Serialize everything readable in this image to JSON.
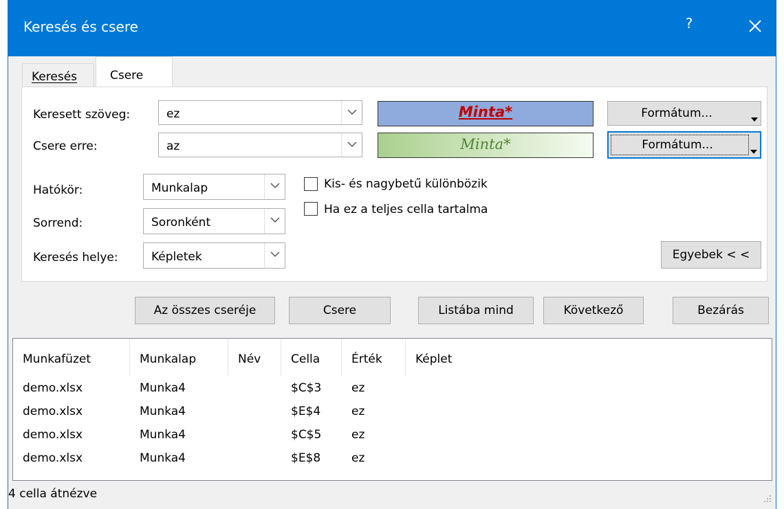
{
  "window": {
    "title": "Keresés és csere",
    "help_label": "?",
    "close_label": "✕"
  },
  "tabs": [
    {
      "label": "Keresés"
    },
    {
      "label": "Csere"
    }
  ],
  "find": {
    "label": "Keresett szöveg:",
    "value": "ez",
    "preview": "Minta*",
    "format_button": "Formátum..."
  },
  "replace": {
    "label": "Csere erre:",
    "value": "az",
    "preview": "Minta*",
    "format_button": "Formátum..."
  },
  "options": {
    "scope_label": "Hatókör:",
    "scope_value": "Munkalap",
    "order_label": "Sorrend:",
    "order_value": "Soronként",
    "lookin_label": "Keresés helye:",
    "lookin_value": "Képletek",
    "match_case": {
      "label": "Kis- és nagybetű különbözik",
      "checked": false
    },
    "match_entire": {
      "label": "Ha ez a teljes cella tartalma",
      "checked": false
    },
    "more_button": "Egyebek < <"
  },
  "actions": {
    "replace_all": "Az összes cseréje",
    "replace": "Csere",
    "find_all": "Listába mind",
    "find_next": "Következő",
    "close": "Bezárás"
  },
  "results": {
    "columns": [
      "Munkafüzet",
      "Munkalap",
      "Név",
      "Cella",
      "Érték",
      "Képlet"
    ],
    "rows": [
      {
        "workbook": "demo.xlsx",
        "sheet": "Munka4",
        "name": "",
        "cell": "$C$3",
        "value": "ez",
        "formula": ""
      },
      {
        "workbook": "demo.xlsx",
        "sheet": "Munka4",
        "name": "",
        "cell": "$E$4",
        "value": "ez",
        "formula": ""
      },
      {
        "workbook": "demo.xlsx",
        "sheet": "Munka4",
        "name": "",
        "cell": "$C$5",
        "value": "ez",
        "formula": ""
      },
      {
        "workbook": "demo.xlsx",
        "sheet": "Munka4",
        "name": "",
        "cell": "$E$8",
        "value": "ez",
        "formula": ""
      }
    ]
  },
  "status": {
    "text": "4 cella átnézve"
  },
  "colors": {
    "titlebar": "#0078d7",
    "find_preview_bg": "#8faadc",
    "find_preview_text": "#c00000",
    "replace_preview_bg": "#a9d08e",
    "replace_preview_text": "#548235"
  }
}
